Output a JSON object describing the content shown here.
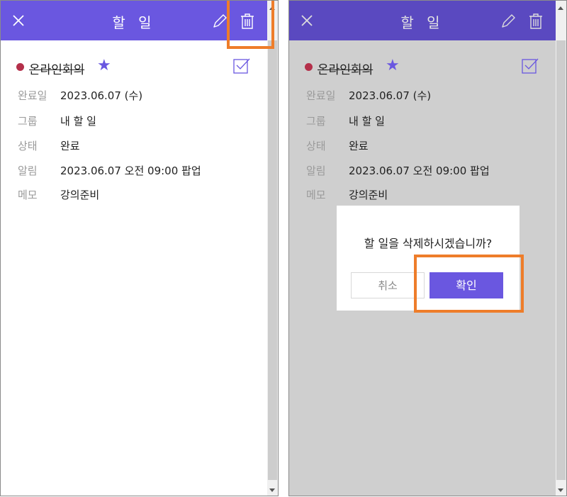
{
  "header": {
    "title": "할 일"
  },
  "task": {
    "title": "온라인회의",
    "starred": true,
    "completed": true
  },
  "details": [
    {
      "label": "완료일",
      "value": "2023.06.07 (수)"
    },
    {
      "label": "그룹",
      "value": "내 할 일"
    },
    {
      "label": "상태",
      "value": "완료"
    },
    {
      "label": "알림",
      "value": "2023.06.07 오전 09:00 팝업"
    },
    {
      "label": "메모",
      "value": "강의준비"
    }
  ],
  "dialog": {
    "message": "할 일을 삭제하시겠습니까?",
    "cancel_label": "취소",
    "confirm_label": "확인"
  },
  "colors": {
    "accent": "#6a57e0",
    "highlight": "#ee7d2a",
    "task_dot": "#b4304a",
    "overlay": "#cfcfcf"
  },
  "icons": [
    "close-icon",
    "edit-icon",
    "trash-icon",
    "star-icon",
    "checkbox-icon"
  ]
}
